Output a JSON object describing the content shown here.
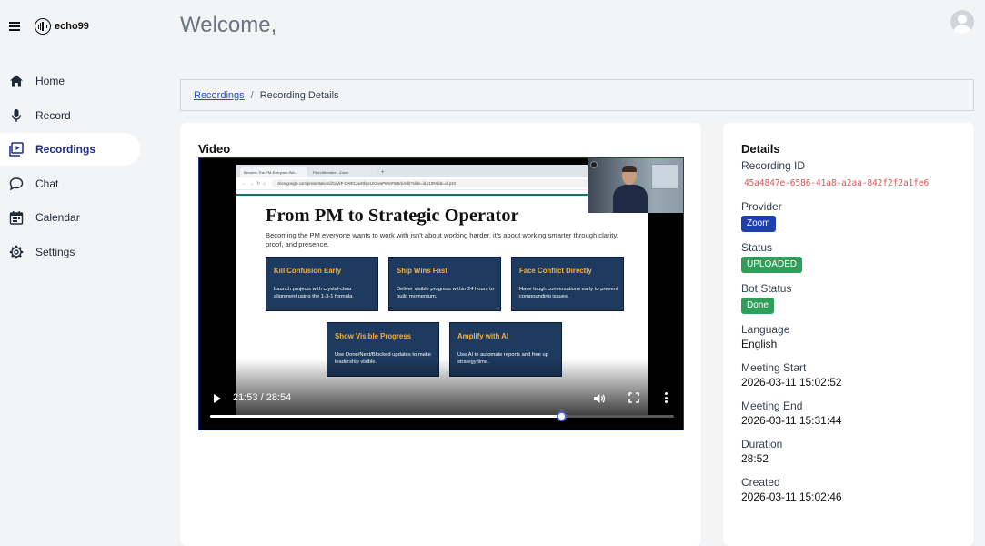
{
  "app": {
    "brand": "echo99",
    "colors": {
      "accent": "#1e2a8a",
      "link": "#1d4ed8",
      "provider_badge": "#1e40af",
      "success_badge": "#2f9e5a",
      "id_text": "#e05252"
    }
  },
  "sidebar": {
    "items": [
      {
        "label": "Home",
        "icon": "home-icon",
        "active": false
      },
      {
        "label": "Record",
        "icon": "microphone-icon",
        "active": false
      },
      {
        "label": "Recordings",
        "icon": "video-library-icon",
        "active": true
      },
      {
        "label": "Chat",
        "icon": "chat-bubble-icon",
        "active": false
      },
      {
        "label": "Calendar",
        "icon": "calendar-icon",
        "active": false
      },
      {
        "label": "Settings",
        "icon": "gear-icon",
        "active": false
      }
    ]
  },
  "header": {
    "welcome": "Welcome,",
    "avatar_icon": "user-avatar-icon"
  },
  "breadcrumb": {
    "link": "Recordings",
    "separator": "/",
    "current": "Recording Details"
  },
  "video": {
    "title": "Video",
    "browser_tabs": [
      "Become-The-PM-Everyone-Wa...",
      "Pixel Attendee - Zoom"
    ],
    "url": "docs.google.com/presentation/d/1dykF-CARGJuvDbpcUX3vwPWmF5Btck/edit?slide=id.p10#slide=id.p10",
    "slide": {
      "title": "From PM to Strategic Operator",
      "subtitle": "Becoming the PM everyone wants to work with isn't about working harder, it's about working smarter through clarity, proof, and presence.",
      "boxes": [
        {
          "title": "Kill Confusion Early",
          "body": "Launch projects with crystal-clear alignment using the 1-3-1 formula."
        },
        {
          "title": "Ship Wins Fast",
          "body": "Deliver visible progress within 24 hours to build momentum."
        },
        {
          "title": "Face Conflict Directly",
          "body": "Have tough conversations early to prevent compounding issues."
        },
        {
          "title": "Show Visible Progress",
          "body": "Use Done/Next/Blocked updates to make leadership visible."
        },
        {
          "title": "Amplify with AI",
          "body": "Use AI to automate reports and free up strategy time."
        }
      ]
    },
    "player": {
      "time": "21:53 / 28:54",
      "progress": 0.757
    }
  },
  "details": {
    "title": "Details",
    "fields": {
      "recording_id_label": "Recording ID",
      "recording_id": "45a4847e-6586-41a8-a2aa-842f2f2a1fe6",
      "provider_label": "Provider",
      "provider": "Zoom",
      "status_label": "Status",
      "status": "UPLOADED",
      "bot_status_label": "Bot Status",
      "bot_status": "Done",
      "language_label": "Language",
      "language": "English",
      "meeting_start_label": "Meeting Start",
      "meeting_start": "2026-03-11 15:02:52",
      "meeting_end_label": "Meeting End",
      "meeting_end": "2026-03-11 15:31:44",
      "duration_label": "Duration",
      "duration": "28:52",
      "created_label": "Created",
      "created": "2026-03-11 15:02:46"
    }
  }
}
